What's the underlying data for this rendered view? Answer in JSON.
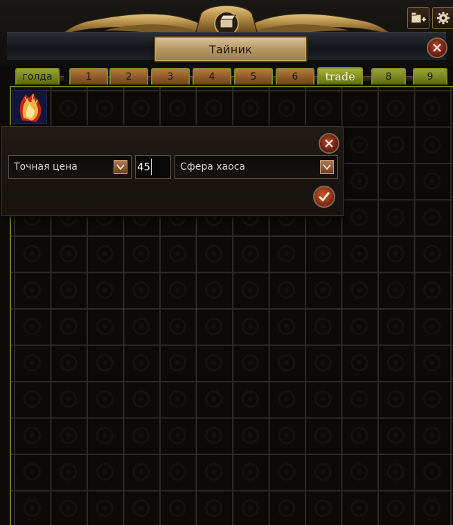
{
  "window": {
    "title": "Тайник",
    "icons": {
      "add_tab": "add-tab-icon",
      "settings": "gear-icon",
      "close": "close-icon"
    }
  },
  "tabs": [
    {
      "label": "голда",
      "style": "gold"
    },
    {
      "label": "1",
      "style": "normal"
    },
    {
      "label": "2",
      "style": "normal"
    },
    {
      "label": "3",
      "style": "normal"
    },
    {
      "label": "4",
      "style": "normal"
    },
    {
      "label": "5",
      "style": "normal"
    },
    {
      "label": "6",
      "style": "normal"
    },
    {
      "label": "trade",
      "style": "active"
    },
    {
      "label": "8",
      "style": "gold"
    },
    {
      "label": "9",
      "style": "gold"
    }
  ],
  "stash_grid": {
    "item": {
      "icon": "flame-shield-item-icon"
    }
  },
  "price_dialog": {
    "mode_label": "Точная цена",
    "amount_value": "45",
    "currency_label": "Сфера хаоса"
  },
  "colors": {
    "tab_border": "#7d8a2c",
    "tab_fill": "#8e5a27",
    "title_plate": "#b89b66"
  }
}
